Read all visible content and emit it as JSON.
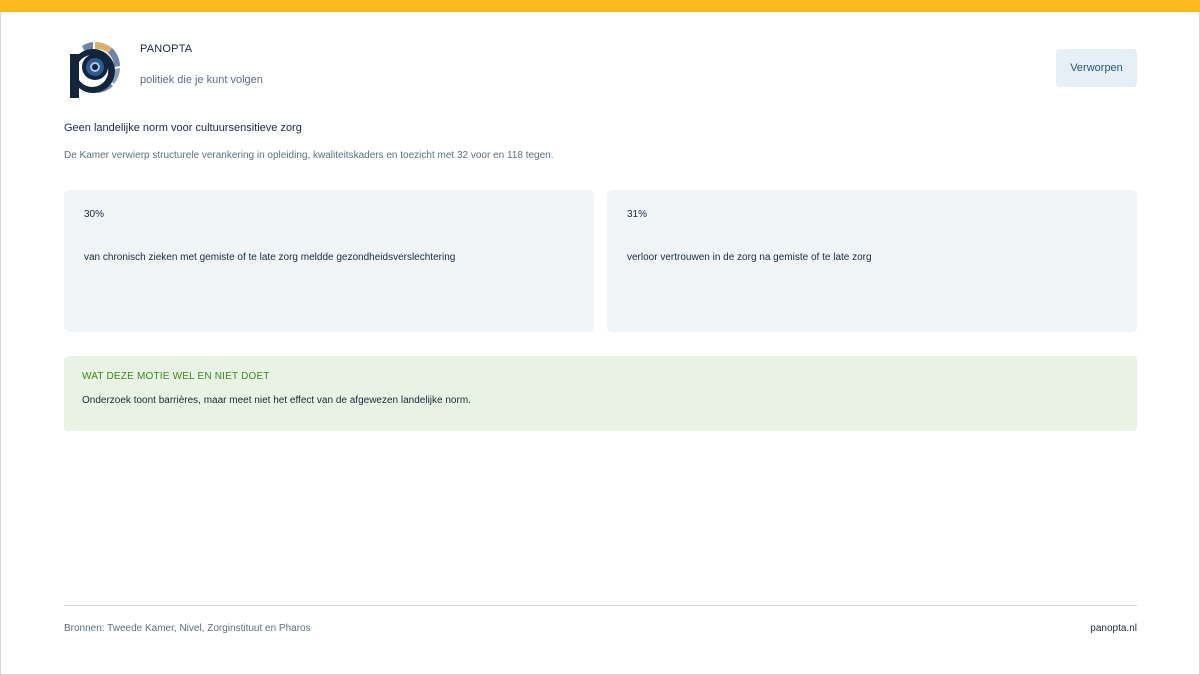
{
  "brand": {
    "name": "PANOPTA",
    "tagline": "politiek die je kunt volgen",
    "logo_icon": "eye-p-logo-icon"
  },
  "status": {
    "label": "Verworpen"
  },
  "motion": {
    "title": "Geen landelijke norm voor cultuursensitieve zorg",
    "summary": "De Kamer verwierp structurele verankering in opleiding, kwaliteitskaders en toezicht met 32 voor en 118 tegen."
  },
  "stats": [
    {
      "value": "30%",
      "label": "van chronisch zieken met gemiste of te late zorg meldde gezondheidsverslechtering"
    },
    {
      "value": "31%",
      "label": "verloor vertrouwen in de zorg na gemiste of te late zorg"
    }
  ],
  "note": {
    "title": "WAT DEZE MOTIE WEL EN NIET DOET",
    "text": "Onderzoek toont barrières, maar meet niet het effect van de afgewezen landelijke norm."
  },
  "footer": {
    "sources": "Bronnen: Tweede Kamer, Nivel, Zorginstituut en Pharos",
    "site": "panopta.nl"
  },
  "colors": {
    "accent_bar": "#fbbb1c",
    "navy": "#1b2a3a",
    "note_green": "#3f8a1e",
    "note_bg": "#e8f2e5",
    "card_bg": "#f1f5f8",
    "badge_bg": "#e6eff5"
  }
}
